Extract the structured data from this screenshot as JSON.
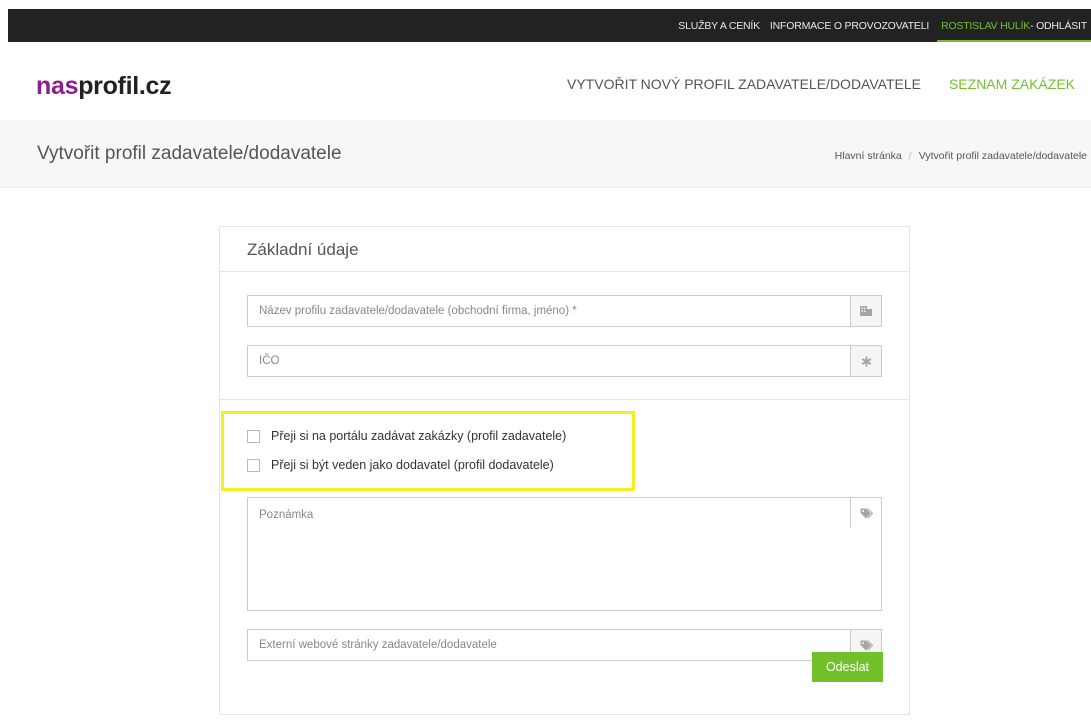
{
  "topbar": {
    "links": [
      "SLUŽBY A CENÍK",
      "INFORMACE O PROVOZOVATELI"
    ],
    "user_name": "ROSTISLAV HULÍK",
    "logout": " - ODHLÁSIT"
  },
  "header": {
    "logo_part1": "nas",
    "logo_part2": "profil.cz",
    "nav": [
      "VYTVOŘIT NOVÝ PROFIL ZADAVATELE/DODAVATELE",
      "SEZNAM ZAKÁZEK"
    ],
    "active_nav_index": 1
  },
  "band": {
    "title": "Vytvořit profil zadavatele/dodavatele",
    "breadcrumb": [
      "Hlavní stránka",
      "Vytvořit profil zadavatele/dodavatele"
    ],
    "separator": "/"
  },
  "form": {
    "title": "Základní údaje",
    "name_placeholder": "Název profilu zadavatele/dodavatele (obchodní firma, jméno) *",
    "ico_placeholder": "IČO",
    "check_contracting": "Přeji si na portálu zadávat zakázky (profil zadavatele)",
    "check_supplier": "Přeji si být veden jako dodavatel (profil dodavatele)",
    "note_placeholder": "Poznámka",
    "web_placeholder": "Externí webové stránky zadavatele/dodavatele",
    "submit_label": "Odeslat"
  },
  "icons": {
    "name_field": "building-icon",
    "ico_field": "asterisk-icon",
    "note_field": "tag-icon",
    "web_field": "tag-icon"
  },
  "colors": {
    "accent_green": "#72c02c",
    "logo_purple": "#8a1f8f",
    "topbar_bg": "#222222",
    "highlight_yellow": "#f7ee22"
  }
}
